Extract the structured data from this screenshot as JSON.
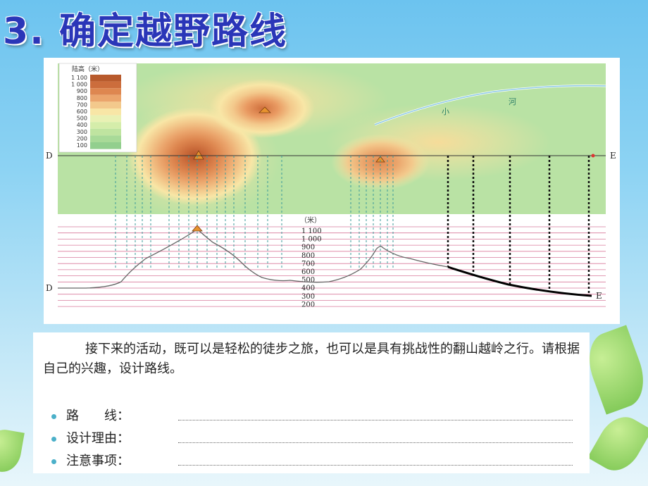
{
  "title": "3. 确定越野路线",
  "map": {
    "legend_title": "陆高（米）",
    "legend_levels": [
      "1 100",
      "1 000",
      "900",
      "800",
      "700",
      "600",
      "500",
      "400",
      "300",
      "200",
      "100"
    ],
    "legend_colors": [
      "#b85a2c",
      "#cc6d3c",
      "#de8750",
      "#eba56c",
      "#f3c98c",
      "#f8e6a6",
      "#e9f1b4",
      "#d5edaa",
      "#bfe4a0",
      "#a8da98",
      "#92cf8e"
    ],
    "river_label_1": "小",
    "river_label_2": "河",
    "point_d": "D",
    "point_e": "E"
  },
  "profile": {
    "unit": "（米）",
    "y_labels": [
      "1 100",
      "1 000",
      "900",
      "800",
      "700",
      "600",
      "500",
      "400",
      "300",
      "200"
    ],
    "point_d": "D",
    "point_e": "E"
  },
  "text": {
    "paragraph": "接下来的活动，既可以是轻松的徒步之旅，也可以是具有挑战性的翻山越岭之行。请根据自己的兴趣，设计路线。",
    "fields": [
      "路　　线：",
      "设计理由：",
      "注意事项："
    ]
  },
  "colors": {
    "title": "#2a36b8",
    "map_bg": "#b9e2a4",
    "line": "#d97a9c"
  }
}
